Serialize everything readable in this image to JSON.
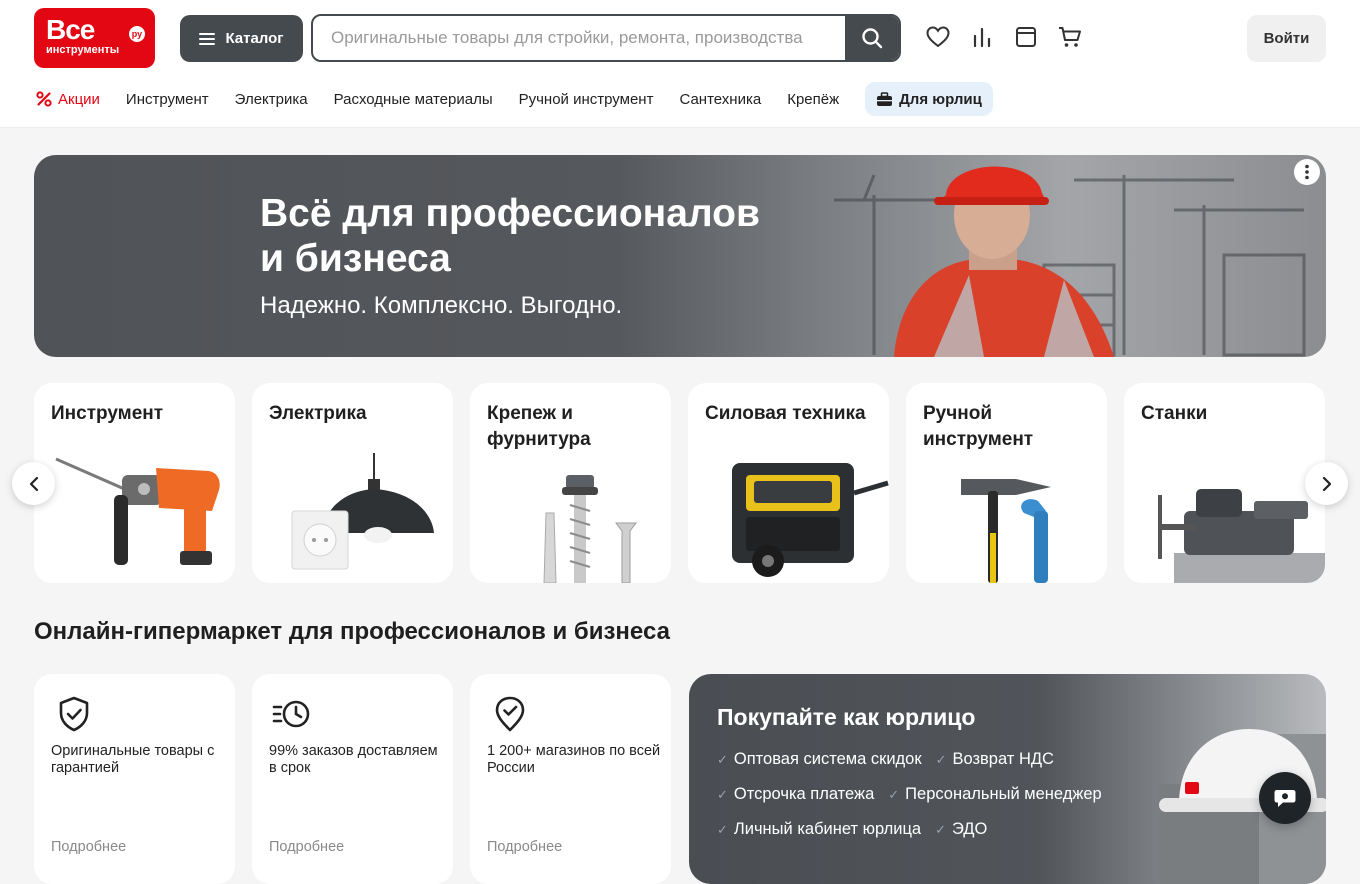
{
  "header": {
    "logo_big": "Все",
    "logo_small": "инструменты",
    "logo_ru": "ру",
    "catalog_label": "Каталог",
    "search_placeholder": "Оригинальные товары для стройки, ремонта, производства",
    "search_value": "",
    "login_label": "Войти",
    "icons": [
      "heart-icon",
      "compare-icon",
      "orders-icon",
      "cart-icon"
    ]
  },
  "nav": {
    "items": [
      {
        "label": "Акции",
        "icon": "percent-icon"
      },
      {
        "label": "Инструмент"
      },
      {
        "label": "Электрика"
      },
      {
        "label": "Расходные материалы"
      },
      {
        "label": "Ручной инструмент"
      },
      {
        "label": "Сантехника"
      },
      {
        "label": "Крепёж"
      },
      {
        "label": "Для юрлиц",
        "icon": "briefcase-icon"
      }
    ]
  },
  "hero": {
    "title_line1": "Всё для профессионалов",
    "title_line2": "и бизнеса",
    "subtitle": "Надежно. Комплексно. Выгодно."
  },
  "categories": [
    {
      "name": "Инструмент"
    },
    {
      "name": "Электрика"
    },
    {
      "name": "Крепеж и фурнитура"
    },
    {
      "name": "Силовая техника"
    },
    {
      "name": "Ручной инструмент"
    },
    {
      "name": "Станки"
    }
  ],
  "section_title": "Онлайн-гипермаркет для профессионалов и бизнеса",
  "features": [
    {
      "text": "Оригинальные товары с гарантией",
      "link": "Подробнее",
      "icon": "shield-check-icon"
    },
    {
      "text": "99% заказов доставляем в срок",
      "link": "Подробнее",
      "icon": "clock-fast-icon"
    },
    {
      "text": "1 200+ магазинов по всей России",
      "link": "Подробнее",
      "icon": "location-check-icon"
    }
  ],
  "b2b": {
    "title": "Покупайте как юрлицо",
    "rows": [
      [
        "Оптовая система скидок",
        "Возврат НДС"
      ],
      [
        "Отсрочка платежа",
        "Персональный менеджер"
      ],
      [
        "Личный кабинет юрлица",
        "ЭДО"
      ]
    ]
  },
  "colors": {
    "brand_red": "#e30613",
    "dark_button": "#454a4f",
    "b2b_nav_bg": "#e6f0fb"
  }
}
